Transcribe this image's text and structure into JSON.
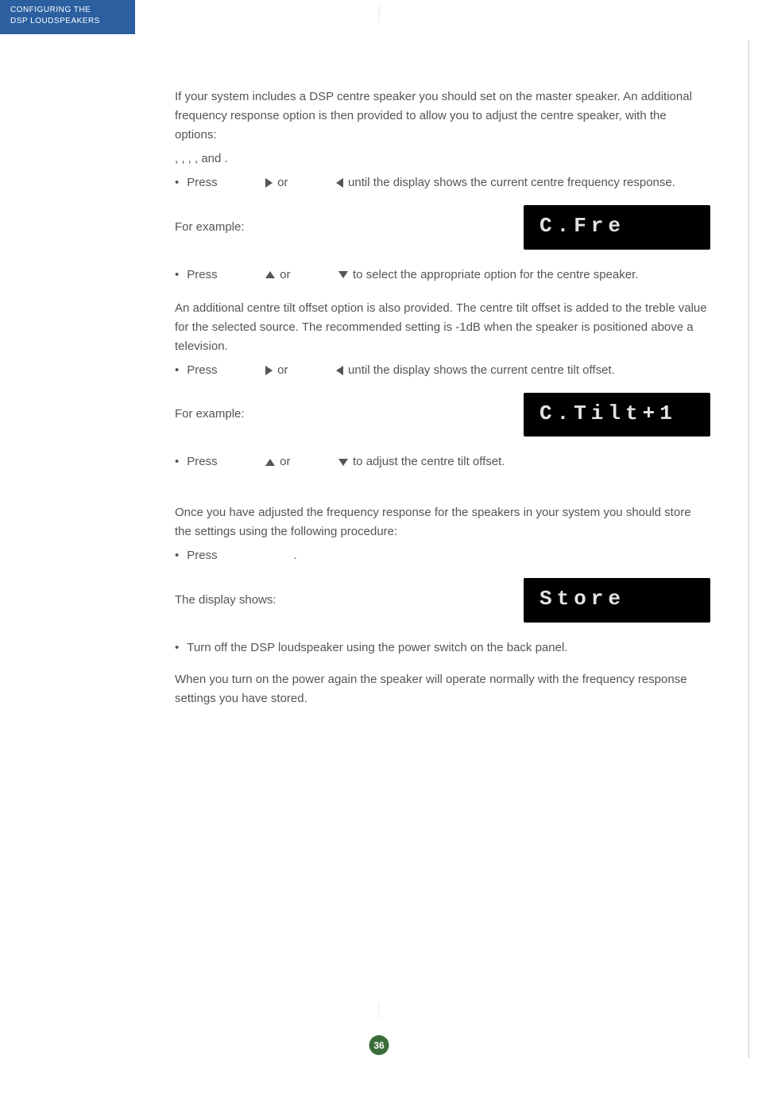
{
  "sidebar": {
    "line1": "CONFIGURING THE",
    "line2": "DSP LOUDSPEAKERS"
  },
  "paragraphs": {
    "p1": "If your system includes a DSP centre speaker you should set                 on the master speaker. An additional frequency response option is then provided to allow you to adjust the centre speaker, with the options:",
    "p2": "        ,           ,           ,              , and         .",
    "p3_press": "Press",
    "p3_or": "or",
    "p3_tail": "until the display shows the current centre frequency response.",
    "for_example": "For example:",
    "p4_press": "Press",
    "p4_or": "or",
    "p4_tail": "to select the appropriate option for the centre speaker.",
    "p5": "An additional centre tilt offset option is also provided. The centre tilt offset is added to the treble value for the selected source. The recommended setting is -1dB when the speaker is positioned above a television.",
    "p6_press": "Press",
    "p6_or": "or",
    "p6_tail": "until the display shows the current centre tilt offset.",
    "p7_press": "Press",
    "p7_or": "or",
    "p7_tail": "to adjust the centre tilt offset.",
    "p8": "Once you have adjusted the frequency response for the speakers in your system you should store the settings using the following procedure:",
    "p9_press": "Press",
    "p9_tail": ".",
    "display_shows": "The display shows:",
    "p10": "Turn off the DSP loudspeaker using the power switch on the back panel.",
    "p11": "When you turn on the power again the speaker will operate normally with the frequency response settings you have stored."
  },
  "lcd": {
    "cfre": "C.Fre",
    "ctilt": "C.Tilt+1",
    "store": "Store"
  },
  "page_number": "36"
}
